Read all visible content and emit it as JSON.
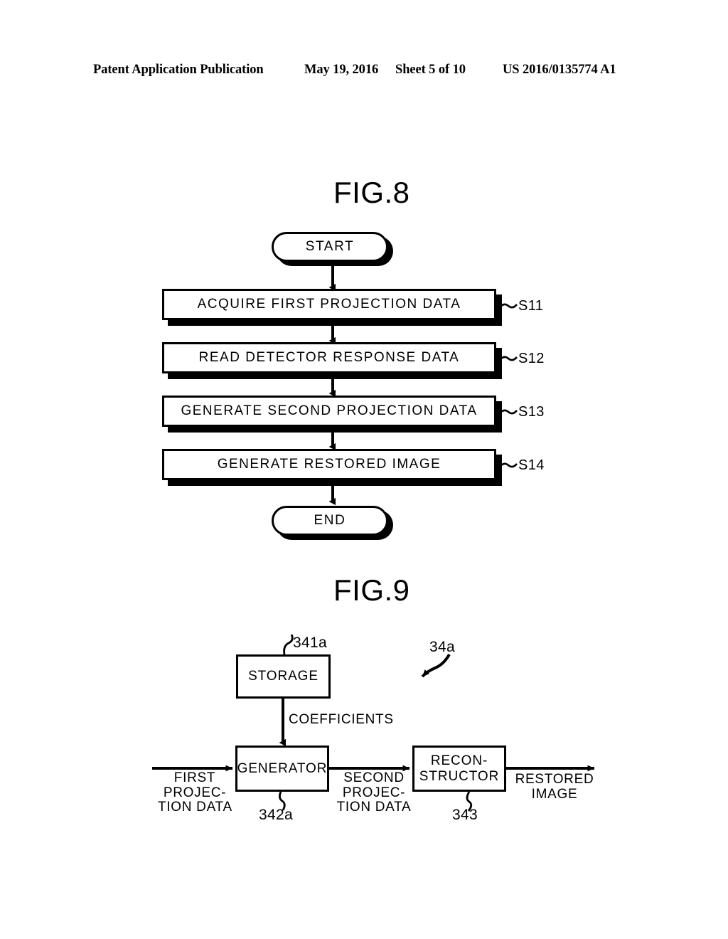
{
  "header": {
    "publication": "Patent Application Publication",
    "date": "May 19, 2016",
    "sheet": "Sheet 5 of 10",
    "number": "US 2016/0135774 A1"
  },
  "figures": [
    {
      "id": "fig8",
      "title": "FIG.8",
      "type": "flowchart",
      "nodes": [
        {
          "id": "start",
          "shape": "terminal",
          "label": "START"
        },
        {
          "id": "s11",
          "shape": "process",
          "label": "ACQUIRE FIRST PROJECTION DATA",
          "ref": "S11"
        },
        {
          "id": "s12",
          "shape": "process",
          "label": "READ DETECTOR RESPONSE DATA",
          "ref": "S12"
        },
        {
          "id": "s13",
          "shape": "process",
          "label": "GENERATE SECOND PROJECTION DATA",
          "ref": "S13"
        },
        {
          "id": "s14",
          "shape": "process",
          "label": "GENERATE RESTORED IMAGE",
          "ref": "S14"
        },
        {
          "id": "end",
          "shape": "terminal",
          "label": "END"
        }
      ]
    },
    {
      "id": "fig9",
      "title": "FIG.9",
      "type": "block-diagram",
      "system_ref": "34a",
      "blocks": [
        {
          "id": "storage",
          "label": "STORAGE",
          "ref": "341a"
        },
        {
          "id": "generator",
          "label": "GENERATOR",
          "ref": "342a"
        },
        {
          "id": "reconstructor",
          "label_line1": "RECON-",
          "label_line2": "STRUCTOR",
          "ref": "343"
        }
      ],
      "signals": [
        {
          "id": "coefficients",
          "label": "COEFFICIENTS"
        },
        {
          "id": "first-projection-data",
          "line1": "FIRST",
          "line2": "PROJEC-",
          "line3": "TION DATA"
        },
        {
          "id": "second-projection-data",
          "line1": "SECOND",
          "line2": "PROJEC-",
          "line3": "TION DATA"
        },
        {
          "id": "restored-image",
          "line1": "RESTORED",
          "line2": "IMAGE"
        }
      ]
    }
  ],
  "colors": {
    "ink": "#000000",
    "paper": "#ffffff"
  }
}
